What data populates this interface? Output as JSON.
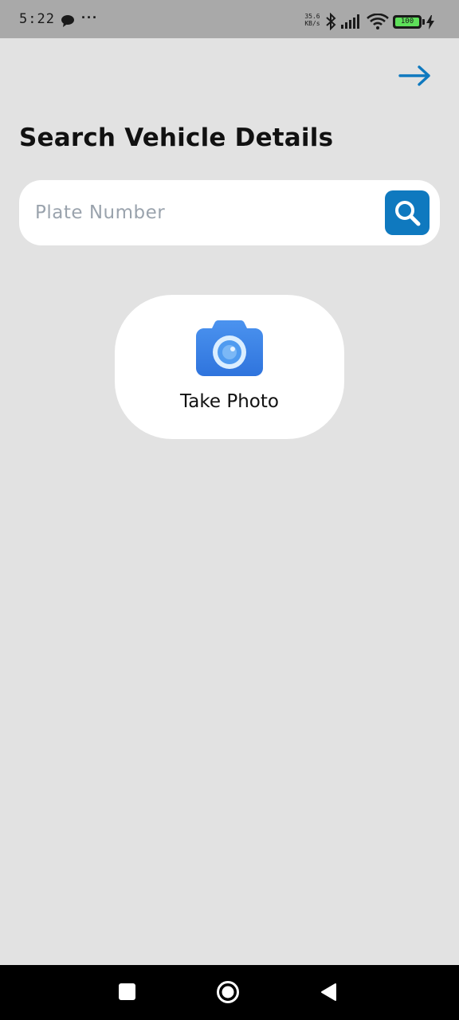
{
  "status_bar": {
    "time": "5:22",
    "dots": "···",
    "net_speed_value": "35.6",
    "net_speed_unit": "KB/s",
    "battery_level": "100",
    "icons": [
      "chat-icon",
      "bluetooth-icon",
      "signal-icon",
      "wifi-icon",
      "battery-icon",
      "charging-icon"
    ]
  },
  "header": {
    "next_icon": "arrow-right-icon",
    "title": "Search Vehicle Details"
  },
  "search": {
    "placeholder": "Plate Number",
    "value": "",
    "button_icon": "search-icon"
  },
  "photo": {
    "label": "Take Photo",
    "icon": "camera-icon"
  },
  "nav_bar": {
    "icons": [
      "recents-icon",
      "home-icon",
      "back-icon"
    ]
  },
  "colors": {
    "accent": "#0f79bf",
    "background": "#e2e2e2",
    "camera_blue": "#3f86e8"
  }
}
